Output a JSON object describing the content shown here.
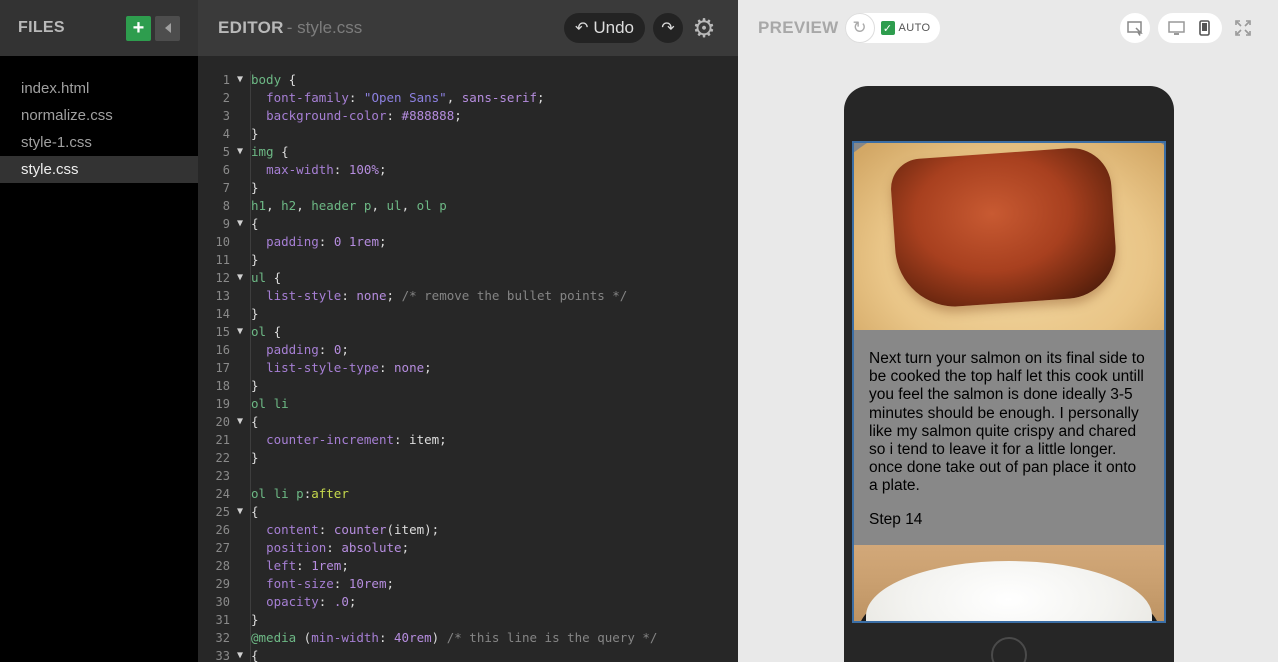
{
  "files": {
    "title": "FILES",
    "add_label": "+",
    "items": [
      {
        "name": "index.html",
        "active": false
      },
      {
        "name": "normalize.css",
        "active": false
      },
      {
        "name": "style-1.css",
        "active": false
      },
      {
        "name": "style.css",
        "active": true
      }
    ]
  },
  "editor": {
    "title": "EDITOR",
    "file": "- style.css",
    "undo_label": "Undo",
    "lines": [
      {
        "n": "1",
        "fold": true,
        "html": "<span class='t-sel'>body</span> <span class='t-pun'>{</span>"
      },
      {
        "n": "2",
        "fold": false,
        "html": "  <span class='t-prop'>font-family</span>: <span class='t-str'>\"Open Sans\"</span>, <span class='t-val'>sans-serif</span>;"
      },
      {
        "n": "3",
        "fold": false,
        "html": "  <span class='t-prop'>background-color</span>: <span class='t-val'>#888888</span>;"
      },
      {
        "n": "4",
        "fold": false,
        "html": "}"
      },
      {
        "n": "5",
        "fold": true,
        "html": "<span class='t-sel'>img</span> {"
      },
      {
        "n": "6",
        "fold": false,
        "html": "  <span class='t-prop'>max-width</span>: <span class='t-val'>100%</span>;"
      },
      {
        "n": "7",
        "fold": false,
        "html": "}"
      },
      {
        "n": "8",
        "fold": false,
        "html": "<span class='t-sel'>h1</span>, <span class='t-sel'>h2</span>, <span class='t-sel'>header p</span>, <span class='t-sel'>ul</span>, <span class='t-sel'>ol p</span>"
      },
      {
        "n": "9",
        "fold": true,
        "html": "{"
      },
      {
        "n": "10",
        "fold": false,
        "html": "  <span class='t-prop'>padding</span>: <span class='t-val'>0 1rem</span>;"
      },
      {
        "n": "11",
        "fold": false,
        "html": "}"
      },
      {
        "n": "12",
        "fold": true,
        "html": "<span class='t-sel'>ul</span> {"
      },
      {
        "n": "13",
        "fold": false,
        "html": "  <span class='t-prop'>list-style</span>: <span class='t-val'>none</span>; <span class='t-com'>/* remove the bullet points */</span>"
      },
      {
        "n": "14",
        "fold": false,
        "html": "}"
      },
      {
        "n": "15",
        "fold": true,
        "html": "<span class='t-sel'>ol</span> {"
      },
      {
        "n": "16",
        "fold": false,
        "html": "  <span class='t-prop'>padding</span>: <span class='t-val'>0</span>;"
      },
      {
        "n": "17",
        "fold": false,
        "html": "  <span class='t-prop'>list-style-type</span>: <span class='t-val'>none</span>;"
      },
      {
        "n": "18",
        "fold": false,
        "html": "}"
      },
      {
        "n": "19",
        "fold": false,
        "html": "<span class='t-sel'>ol li</span>"
      },
      {
        "n": "20",
        "fold": true,
        "html": "{"
      },
      {
        "n": "21",
        "fold": false,
        "html": "  <span class='t-prop'>counter-increment</span>: item;"
      },
      {
        "n": "22",
        "fold": false,
        "html": "}"
      },
      {
        "n": "23",
        "fold": false,
        "html": ""
      },
      {
        "n": "24",
        "fold": false,
        "html": "<span class='t-sel'>ol li p</span>:<span class='t-pse'>after</span>"
      },
      {
        "n": "25",
        "fold": true,
        "html": "{"
      },
      {
        "n": "26",
        "fold": false,
        "html": "  <span class='t-prop'>content</span>: <span class='t-val'>counter</span>(item);"
      },
      {
        "n": "27",
        "fold": false,
        "html": "  <span class='t-prop'>position</span>: <span class='t-val'>absolute</span>;"
      },
      {
        "n": "28",
        "fold": false,
        "html": "  <span class='t-prop'>left</span>: <span class='t-val'>1rem</span>;"
      },
      {
        "n": "29",
        "fold": false,
        "html": "  <span class='t-prop'>font-size</span>: <span class='t-val'>10rem</span>;"
      },
      {
        "n": "30",
        "fold": false,
        "html": "  <span class='t-prop'>opacity</span>: <span class='t-val'>.0</span>;"
      },
      {
        "n": "31",
        "fold": false,
        "html": "}"
      },
      {
        "n": "32",
        "fold": false,
        "html": "<span class='t-at'>@media</span> (<span class='t-prop'>min-width</span>: <span class='t-val'>40rem</span>) <span class='t-com'>/* this line is the query */</span>"
      },
      {
        "n": "33",
        "fold": true,
        "html": "{"
      }
    ]
  },
  "preview": {
    "title": "PREVIEW",
    "auto_label": "AUTO",
    "step_text": "Next turn your salmon on its final side to be cooked the top half let this cook untill you feel the salmon is done ideally 3-5 minutes should be enough. I personally like my salmon quite crispy and chared so i tend to leave it for a little longer. once done take out of pan place it onto a plate.",
    "step_label": "Step 14"
  },
  "colors": {
    "accent_green": "#2e9d4e",
    "editor_bg": "#272727",
    "preview_bg": "#e9e9e9",
    "page_bg": "#888888"
  },
  "icons": [
    "plus-icon",
    "collapse-arrow-icon",
    "undo-icon",
    "redo-icon",
    "gear-icon",
    "refresh-icon",
    "checkbox-icon",
    "inspect-icon",
    "desktop-icon",
    "phone-icon",
    "fullscreen-icon"
  ]
}
